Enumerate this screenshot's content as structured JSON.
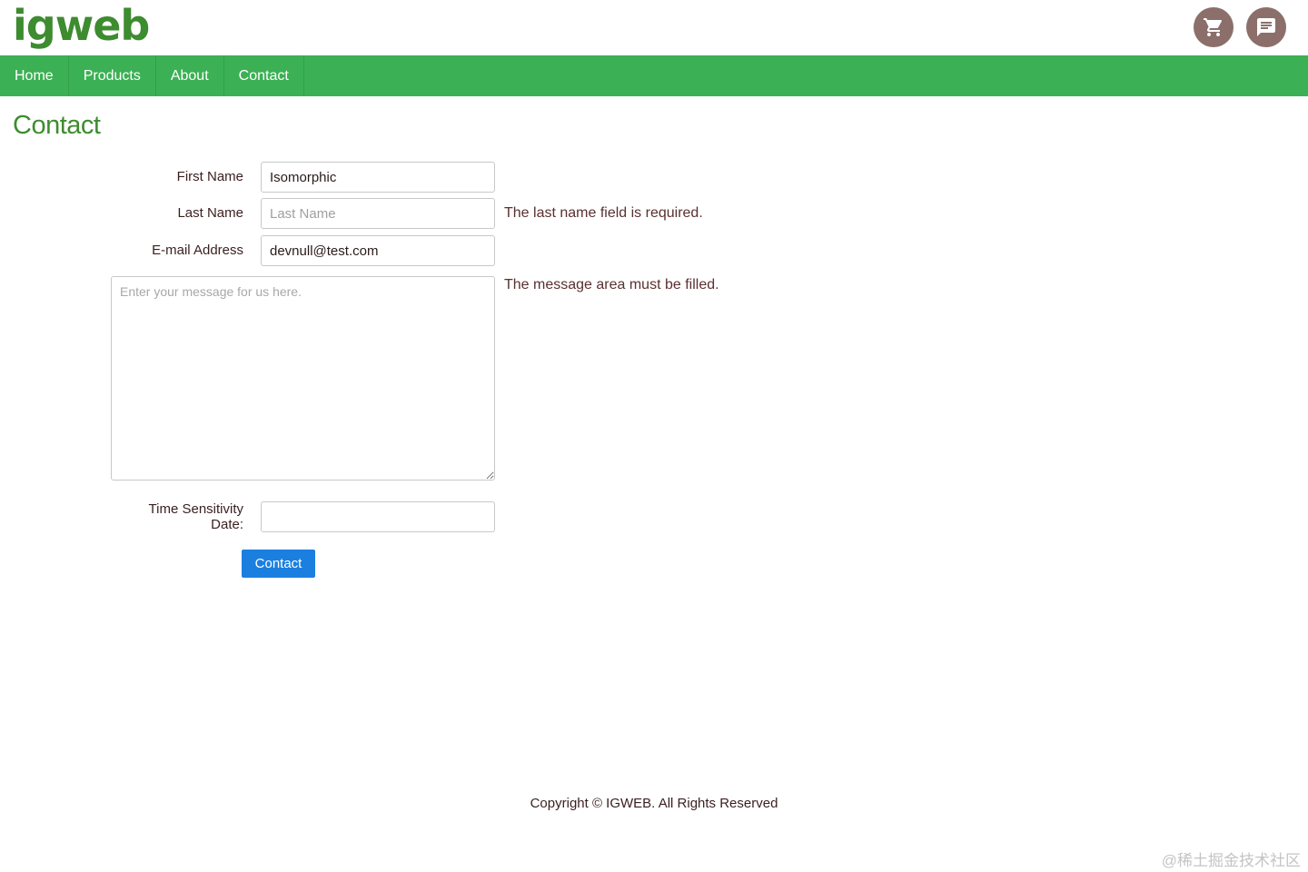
{
  "header": {
    "logo": "igweb",
    "icons": [
      "shopping-cart-icon",
      "chat-icon"
    ]
  },
  "nav": {
    "items": [
      {
        "label": "Home"
      },
      {
        "label": "Products"
      },
      {
        "label": "About"
      },
      {
        "label": "Contact"
      }
    ]
  },
  "page": {
    "title": "Contact"
  },
  "form": {
    "first_name": {
      "label": "First Name",
      "value": "Isomorphic",
      "placeholder": ""
    },
    "last_name": {
      "label": "Last Name",
      "value": "",
      "placeholder": "Last Name",
      "error": "The last name field is required."
    },
    "email": {
      "label": "E-mail Address",
      "value": "devnull@test.com",
      "placeholder": ""
    },
    "message": {
      "value": "",
      "placeholder": "Enter your message for us here.",
      "error": "The message area must be filled."
    },
    "time_sensitivity": {
      "label_line1": "Time Sensitivity",
      "label_line2": "Date:",
      "value": ""
    },
    "submit_label": "Contact"
  },
  "footer": {
    "copyright": "Copyright © IGWEB. All Rights Reserved"
  },
  "watermark": "@稀土掘金技术社区",
  "colors": {
    "brand_green": "#3d8c2f",
    "nav_green": "#3cb054",
    "button_blue": "#1b7fe0",
    "icon_bg": "#8c6f6a"
  }
}
